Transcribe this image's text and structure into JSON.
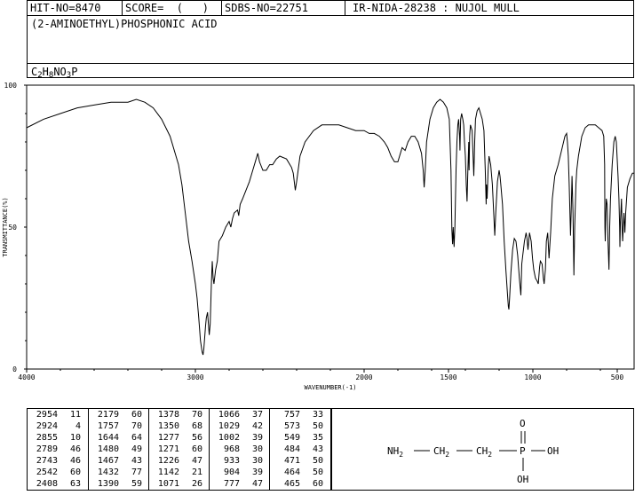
{
  "header": {
    "hit_no": "HIT-NO=8470",
    "score": "SCORE=  (   )",
    "sdbs_no": "SDBS-NO=22751",
    "ir_info": "IR-NIDA-28238 : NUJOL MULL",
    "compound_name": "(2-AMINOETHYL)PHOSPHONIC ACID",
    "formula": {
      "c": "C",
      "c_n": "2",
      "h": "H",
      "h_n": "8",
      "rest": "NO",
      "o_n": "3",
      "p": "P"
    }
  },
  "chart_data": {
    "type": "line",
    "xlabel": "WAVENUMBER(-1)",
    "ylabel": "TRANSMITTANCE(%)",
    "xlim": [
      4000,
      400
    ],
    "ylim": [
      0,
      100
    ],
    "x_ticks": [
      4000,
      3000,
      2000,
      1500,
      1000,
      500
    ],
    "y_ticks": [
      0,
      50,
      100
    ],
    "x_tick_labels": [
      "4000",
      "3000",
      "2000",
      "1500",
      "1000",
      "500"
    ],
    "y_tick_labels": [
      "0",
      "50",
      "100"
    ],
    "grid": false,
    "series": [
      {
        "points": [
          [
            4000,
            85
          ],
          [
            3900,
            88
          ],
          [
            3800,
            90
          ],
          [
            3700,
            92
          ],
          [
            3600,
            93
          ],
          [
            3500,
            94
          ],
          [
            3400,
            94
          ],
          [
            3350,
            95
          ],
          [
            3300,
            94
          ],
          [
            3250,
            92
          ],
          [
            3200,
            88
          ],
          [
            3150,
            82
          ],
          [
            3100,
            72
          ],
          [
            3080,
            65
          ],
          [
            3060,
            55
          ],
          [
            3040,
            45
          ],
          [
            3020,
            38
          ],
          [
            3000,
            30
          ],
          [
            2990,
            25
          ],
          [
            2980,
            18
          ],
          [
            2970,
            10
          ],
          [
            2960,
            6
          ],
          [
            2955,
            5
          ],
          [
            2950,
            7
          ],
          [
            2940,
            15
          ],
          [
            2935,
            18
          ],
          [
            2928,
            20
          ],
          [
            2924,
            17
          ],
          [
            2918,
            12
          ],
          [
            2912,
            16
          ],
          [
            2905,
            30
          ],
          [
            2900,
            38
          ],
          [
            2895,
            32
          ],
          [
            2890,
            30
          ],
          [
            2880,
            35
          ],
          [
            2870,
            38
          ],
          [
            2860,
            45
          ],
          [
            2840,
            47
          ],
          [
            2820,
            50
          ],
          [
            2800,
            52
          ],
          [
            2790,
            50
          ],
          [
            2780,
            53
          ],
          [
            2770,
            55
          ],
          [
            2750,
            56
          ],
          [
            2743,
            54
          ],
          [
            2735,
            58
          ],
          [
            2720,
            60
          ],
          [
            2700,
            63
          ],
          [
            2680,
            66
          ],
          [
            2660,
            70
          ],
          [
            2640,
            74
          ],
          [
            2630,
            76
          ],
          [
            2620,
            73
          ],
          [
            2600,
            70
          ],
          [
            2580,
            70
          ],
          [
            2560,
            72
          ],
          [
            2542,
            72
          ],
          [
            2520,
            74
          ],
          [
            2500,
            75
          ],
          [
            2460,
            74
          ],
          [
            2430,
            71
          ],
          [
            2420,
            69
          ],
          [
            2408,
            63
          ],
          [
            2400,
            66
          ],
          [
            2380,
            75
          ],
          [
            2350,
            80
          ],
          [
            2300,
            84
          ],
          [
            2250,
            86
          ],
          [
            2200,
            86
          ],
          [
            2150,
            86
          ],
          [
            2100,
            85
          ],
          [
            2050,
            84
          ],
          [
            2000,
            84
          ],
          [
            1970,
            83
          ],
          [
            1940,
            83
          ],
          [
            1910,
            82
          ],
          [
            1880,
            80
          ],
          [
            1860,
            78
          ],
          [
            1840,
            75
          ],
          [
            1820,
            73
          ],
          [
            1800,
            73
          ],
          [
            1790,
            75
          ],
          [
            1775,
            78
          ],
          [
            1757,
            77
          ],
          [
            1740,
            80
          ],
          [
            1720,
            82
          ],
          [
            1700,
            82
          ],
          [
            1680,
            80
          ],
          [
            1660,
            76
          ],
          [
            1650,
            70
          ],
          [
            1644,
            64
          ],
          [
            1638,
            70
          ],
          [
            1630,
            80
          ],
          [
            1610,
            88
          ],
          [
            1590,
            92
          ],
          [
            1570,
            94
          ],
          [
            1550,
            95
          ],
          [
            1530,
            94
          ],
          [
            1510,
            92
          ],
          [
            1495,
            88
          ],
          [
            1485,
            70
          ],
          [
            1480,
            49
          ],
          [
            1476,
            44
          ],
          [
            1472,
            50
          ],
          [
            1467,
            43
          ],
          [
            1462,
            50
          ],
          [
            1455,
            70
          ],
          [
            1450,
            80
          ],
          [
            1445,
            86
          ],
          [
            1440,
            88
          ],
          [
            1434,
            82
          ],
          [
            1432,
            77
          ],
          [
            1428,
            88
          ],
          [
            1422,
            90
          ],
          [
            1415,
            88
          ],
          [
            1410,
            86
          ],
          [
            1405,
            80
          ],
          [
            1400,
            75
          ],
          [
            1395,
            65
          ],
          [
            1390,
            59
          ],
          [
            1385,
            70
          ],
          [
            1380,
            80
          ],
          [
            1378,
            70
          ],
          [
            1375,
            82
          ],
          [
            1370,
            86
          ],
          [
            1360,
            84
          ],
          [
            1350,
            68
          ],
          [
            1345,
            80
          ],
          [
            1340,
            88
          ],
          [
            1330,
            91
          ],
          [
            1320,
            92
          ],
          [
            1310,
            90
          ],
          [
            1300,
            88
          ],
          [
            1290,
            84
          ],
          [
            1282,
            70
          ],
          [
            1277,
            58
          ],
          [
            1275,
            65
          ],
          [
            1271,
            60
          ],
          [
            1265,
            70
          ],
          [
            1260,
            75
          ],
          [
            1250,
            72
          ],
          [
            1240,
            65
          ],
          [
            1232,
            55
          ],
          [
            1226,
            47
          ],
          [
            1220,
            55
          ],
          [
            1210,
            66
          ],
          [
            1200,
            70
          ],
          [
            1195,
            68
          ],
          [
            1190,
            65
          ],
          [
            1180,
            58
          ],
          [
            1170,
            45
          ],
          [
            1160,
            35
          ],
          [
            1150,
            26
          ],
          [
            1145,
            22
          ],
          [
            1142,
            21
          ],
          [
            1138,
            25
          ],
          [
            1130,
            34
          ],
          [
            1120,
            42
          ],
          [
            1110,
            46
          ],
          [
            1100,
            45
          ],
          [
            1090,
            40
          ],
          [
            1080,
            32
          ],
          [
            1071,
            26
          ],
          [
            1066,
            37
          ],
          [
            1060,
            40
          ],
          [
            1050,
            45
          ],
          [
            1040,
            48
          ],
          [
            1035,
            46
          ],
          [
            1029,
            42
          ],
          [
            1025,
            45
          ],
          [
            1020,
            48
          ],
          [
            1010,
            45
          ],
          [
            1002,
            39
          ],
          [
            995,
            35
          ],
          [
            985,
            32
          ],
          [
            975,
            31
          ],
          [
            968,
            30
          ],
          [
            960,
            36
          ],
          [
            955,
            38
          ],
          [
            945,
            37
          ],
          [
            938,
            32
          ],
          [
            933,
            30
          ],
          [
            926,
            35
          ],
          [
            920,
            45
          ],
          [
            912,
            48
          ],
          [
            904,
            39
          ],
          [
            895,
            48
          ],
          [
            885,
            60
          ],
          [
            870,
            68
          ],
          [
            850,
            72
          ],
          [
            830,
            77
          ],
          [
            810,
            82
          ],
          [
            800,
            83
          ],
          [
            795,
            80
          ],
          [
            790,
            75
          ],
          [
            785,
            65
          ],
          [
            777,
            47
          ],
          [
            773,
            55
          ],
          [
            768,
            68
          ],
          [
            762,
            55
          ],
          [
            757,
            33
          ],
          [
            752,
            50
          ],
          [
            745,
            65
          ],
          [
            740,
            70
          ],
          [
            730,
            75
          ],
          [
            710,
            82
          ],
          [
            690,
            85
          ],
          [
            670,
            86
          ],
          [
            650,
            86
          ],
          [
            630,
            86
          ],
          [
            610,
            85
          ],
          [
            590,
            84
          ],
          [
            580,
            82
          ],
          [
            575,
            72
          ],
          [
            573,
            50
          ],
          [
            571,
            45
          ],
          [
            568,
            55
          ],
          [
            565,
            60
          ],
          [
            560,
            58
          ],
          [
            555,
            45
          ],
          [
            549,
            35
          ],
          [
            545,
            50
          ],
          [
            540,
            60
          ],
          [
            530,
            72
          ],
          [
            520,
            80
          ],
          [
            512,
            82
          ],
          [
            505,
            80
          ],
          [
            495,
            68
          ],
          [
            490,
            60
          ],
          [
            486,
            50
          ],
          [
            484,
            43
          ],
          [
            481,
            52
          ],
          [
            475,
            60
          ],
          [
            471,
            50
          ],
          [
            468,
            45
          ],
          [
            464,
            50
          ],
          [
            460,
            55
          ],
          [
            455,
            48
          ],
          [
            450,
            55
          ],
          [
            440,
            64
          ],
          [
            425,
            67
          ],
          [
            410,
            69
          ],
          [
            400,
            69
          ]
        ]
      }
    ],
    "peaks": [
      [
        2954,
        11
      ],
      [
        2924,
        4
      ],
      [
        2855,
        10
      ],
      [
        2789,
        46
      ],
      [
        2743,
        46
      ],
      [
        2542,
        60
      ],
      [
        2408,
        63
      ],
      [
        2179,
        60
      ],
      [
        1757,
        70
      ],
      [
        1644,
        64
      ],
      [
        1480,
        49
      ],
      [
        1467,
        43
      ],
      [
        1432,
        77
      ],
      [
        1390,
        59
      ],
      [
        1378,
        70
      ],
      [
        1350,
        68
      ],
      [
        1277,
        56
      ],
      [
        1271,
        60
      ],
      [
        1226,
        47
      ],
      [
        1142,
        21
      ],
      [
        1071,
        26
      ],
      [
        1066,
        37
      ],
      [
        1029,
        42
      ],
      [
        1002,
        39
      ],
      [
        968,
        30
      ],
      [
        933,
        30
      ],
      [
        904,
        39
      ],
      [
        777,
        47
      ],
      [
        757,
        33
      ],
      [
        573,
        50
      ],
      [
        549,
        35
      ],
      [
        484,
        43
      ],
      [
        471,
        50
      ],
      [
        464,
        50
      ],
      [
        465,
        60
      ]
    ]
  },
  "structure": {
    "nh2": "NH",
    "nh2_sub": "2",
    "ch2a": "CH",
    "ch2a_sub": "2",
    "ch2b": "CH",
    "ch2b_sub": "2",
    "p": "P",
    "oh_right": "OH",
    "o_top": "O",
    "oh_bottom": "OH"
  }
}
